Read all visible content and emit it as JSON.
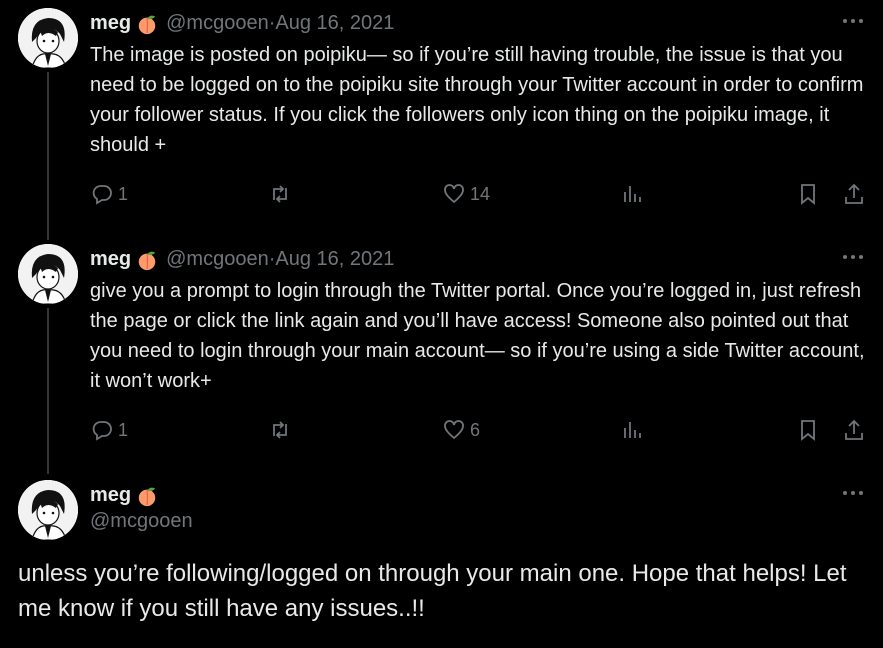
{
  "tweets": [
    {
      "name": "meg",
      "emoji": "🍑",
      "handle": "@mcgooen",
      "date": "Aug 16, 2021",
      "text": "The image is posted on poipiku— so if you’re still having trouble, the issue is that you need to be logged on to the poipiku site through your Twitter account in order to confirm your follower status. If you click the followers only icon thing on the poipiku image, it should +",
      "replies": "1",
      "likes": "14"
    },
    {
      "name": "meg",
      "emoji": "🍑",
      "handle": "@mcgooen",
      "date": "Aug 16, 2021",
      "text": "give you a prompt to login through the Twitter portal. Once you’re logged in, just refresh the page or click the link again and you’ll have access! Someone also pointed out that you need to login through your main account— so if you’re using a side Twitter account, it won’t work+",
      "replies": "1",
      "likes": "6"
    }
  ],
  "main_tweet": {
    "name": "meg",
    "emoji": "🍑",
    "handle": "@mcgooen",
    "text": "unless you’re following/logged on through your main one. Hope that helps! Let me know if you still have any issues..!!"
  },
  "separator": " · ",
  "icons": [
    "reply-icon",
    "retweet-icon",
    "like-icon",
    "views-icon",
    "bookmark-icon",
    "share-icon",
    "more-icon"
  ],
  "colors": {
    "background": "#000000",
    "text": "#e7e9ea",
    "muted": "#71767b",
    "thread_line": "#333639"
  }
}
